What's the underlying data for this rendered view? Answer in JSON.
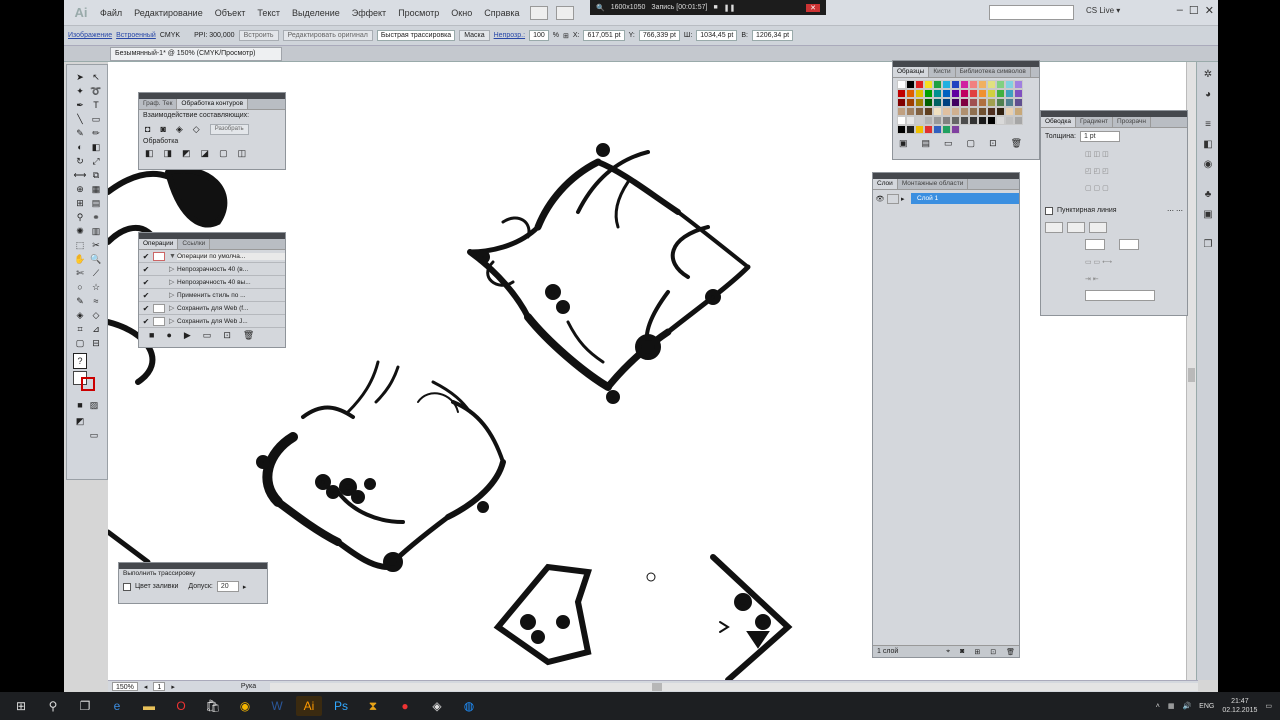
{
  "menubar": {
    "logo": "Ai",
    "items": [
      "Файл",
      "Редактирование",
      "Объект",
      "Текст",
      "Выделение",
      "Эффект",
      "Просмотр",
      "Окно",
      "Справка"
    ],
    "search_placeholder": "",
    "cslive": "CS Live ▾"
  },
  "recorder": {
    "size": "1600x1050",
    "label": "Запись [00:01:57]"
  },
  "controlbar": {
    "image_link": "Изображение",
    "embedded_link": "Встроенный",
    "color_mode": "CMYK",
    "ppi": "PPI: 300,000",
    "embed_btn": "Встроить",
    "edit_original_btn": "Редактировать оригинал",
    "trace_preset": "Быстрая трассировка",
    "mask_label": "Маска",
    "opacity_label": "Непрозр.:",
    "opacity_value": "100",
    "percent": "%",
    "x_value": "617,051 pt",
    "y_value": "766,339 pt",
    "w_value": "1034,45 pt",
    "h_value": "1206,34 pt"
  },
  "document": {
    "tab_title": "Безымянный-1* @ 150% (CMYK/Просмотр)"
  },
  "panels": {
    "trace_panel": {
      "tabs": [
        "Граф. Тек",
        "Обработка контуров"
      ],
      "shape_modes_label": "Взаимодействие составляющих:",
      "expand_btn": "Разобрать",
      "pathfinders_label": "Обработка"
    },
    "actions_panel": {
      "tabs": [
        "Операции",
        "Ссылки"
      ],
      "rows": [
        {
          "label": "Операции по умолча...",
          "checked": "✔",
          "active": true
        },
        {
          "label": "Непрозрачность 40 (в...",
          "checked": "✔",
          "active": false
        },
        {
          "label": "Непрозрачность 40 вы...",
          "checked": "✔",
          "active": false
        },
        {
          "label": "Применить стиль по ...",
          "checked": "✔",
          "active": false
        },
        {
          "label": "Сохранить для Web (f...",
          "checked": "✔",
          "active": false
        },
        {
          "label": "Сохранить для Web J...",
          "checked": "✔",
          "active": false
        }
      ]
    },
    "swatches_panel": {
      "tabs": [
        "Образцы",
        "Кисти",
        "Библиотека символов"
      ]
    },
    "layers_panel": {
      "tabs": [
        "Слои",
        "Монтажные области"
      ],
      "layer_name": "Слой 1",
      "footer": "1 слой"
    },
    "stroke_panel": {
      "tabs": [
        "Обводка",
        "Градиент",
        "Прозрачн"
      ],
      "weight_label": "Толщина:",
      "weight_value": "1 pt",
      "dashed_label": "Пунктирная линия"
    },
    "tracing_panel": {
      "title": "Выполнить трассировку",
      "checkbox_label": "Цвет заливки",
      "tolerance_label": "Допуск:",
      "tolerance_value": "20"
    }
  },
  "statusbar": {
    "zoom": "150%",
    "artboard": "1",
    "status": "Рука"
  },
  "taskbar": {
    "lang": "ENG",
    "time": "21:47",
    "date": "02.12.2015"
  }
}
